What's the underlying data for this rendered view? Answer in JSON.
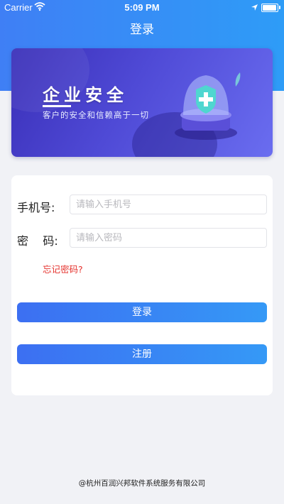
{
  "status_bar": {
    "carrier": "Carrier",
    "time": "5:09 PM"
  },
  "nav": {
    "title": "登录"
  },
  "banner": {
    "title": "企业安全",
    "subtitle": "客户的安全和信赖高于一切"
  },
  "form": {
    "phone_label": "手机号:",
    "phone_placeholder": "请输入手机号",
    "password_label": "密    码:",
    "password_placeholder": "请输入密码",
    "forgot_label": "忘记密码?"
  },
  "buttons": {
    "login_label": "登录",
    "register_label": "注册"
  },
  "footer": {
    "copyright": "@杭州百润兴邦软件系统服务有限公司"
  },
  "colors": {
    "header": "#3f7ff5",
    "accent_button": "#3c6ff2",
    "link_red": "#e5322d",
    "banner": "#4f4ad6"
  }
}
